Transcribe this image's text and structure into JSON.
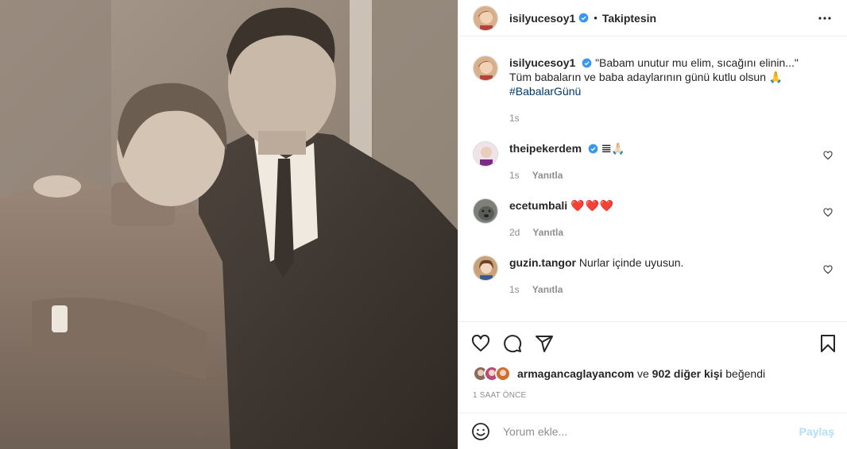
{
  "post": {
    "author": "isilyucesoy1",
    "follow_status": "Takiptesin",
    "separator": "•",
    "caption_line1": "\"Babam unutur mu elim, sıcağını elinin...\"",
    "caption_line2": "Tüm babaların ve baba adaylarının günü kutlu olsun 🙏",
    "hashtag": "#BabalarGünü",
    "caption_time": "1s"
  },
  "comments": [
    {
      "user": "theipekerdem",
      "text": "𝌆🙏🏻",
      "time": "1s",
      "reply": "Yanıtla"
    },
    {
      "user": "ecetumbali",
      "text": "❤️❤️❤️",
      "time": "2d",
      "reply": "Yanıtla"
    },
    {
      "user": "guzin.tangor",
      "text": "Nurlar içinde uyusun.",
      "time": "1s",
      "reply": "Yanıtla"
    }
  ],
  "likes": {
    "user": "armagancaglayancom",
    "connector": "ve",
    "count_text": "902 diğer kişi",
    "suffix": "beğendi"
  },
  "timestamp": "1 SAAT ÖNCE",
  "comment_box": {
    "placeholder": "Yorum ekle...",
    "post_label": "Paylaş"
  },
  "icons": {
    "more": "more-horizontal-icon",
    "like": "heart-outline-icon",
    "comment": "comment-bubble-icon",
    "share": "paper-plane-icon",
    "save": "bookmark-icon",
    "emoji": "smiley-icon",
    "verified": "verified-badge-icon"
  },
  "colors": {
    "verified": "#3897f0",
    "link": "#00376b",
    "post_button_disabled": "#b2dffc",
    "muted": "#8e8e8e"
  }
}
